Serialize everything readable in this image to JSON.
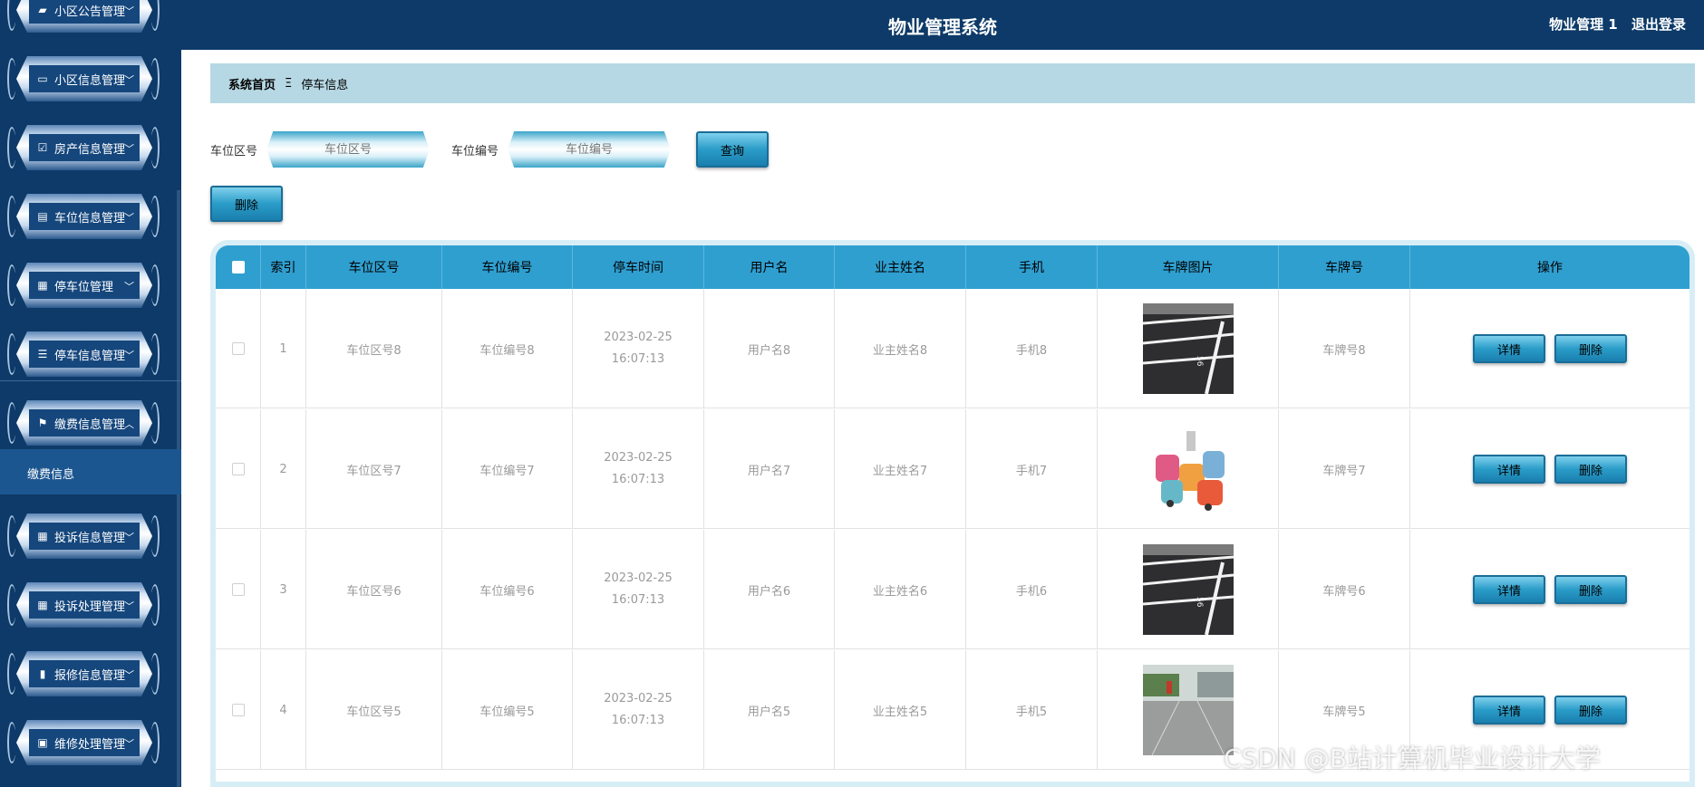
{
  "header": {
    "title": "物业管理系统",
    "user": "物业管理 1",
    "logout": "退出登录"
  },
  "sidebar": {
    "items": [
      {
        "label": "小区公告管理",
        "icon": "wallet-icon"
      },
      {
        "label": "小区信息管理",
        "icon": "monitor-icon"
      },
      {
        "label": "房产信息管理",
        "icon": "clipboard-check-icon"
      },
      {
        "label": "车位信息管理",
        "icon": "clipboard-icon"
      },
      {
        "label": "停车位管理",
        "icon": "grid-icon"
      },
      {
        "label": "停车信息管理",
        "icon": "list-icon"
      },
      {
        "label": "缴费信息管理",
        "icon": "flag-icon"
      },
      {
        "label": "投诉信息管理",
        "icon": "grid-icon"
      },
      {
        "label": "投诉处理管理",
        "icon": "grid-icon"
      },
      {
        "label": "报修信息管理",
        "icon": "book-icon"
      },
      {
        "label": "维修处理管理",
        "icon": "chat-icon"
      }
    ],
    "sub_item": "缴费信息"
  },
  "breadcrumb": {
    "home": "系统首页",
    "separator": "Ξ",
    "current": "停车信息"
  },
  "search": {
    "area_label": "车位区号",
    "area_placeholder": "车位区号",
    "number_label": "车位编号",
    "number_placeholder": "车位编号",
    "query_button": "查询",
    "delete_button": "删除"
  },
  "table": {
    "columns": [
      "索引",
      "车位区号",
      "车位编号",
      "停车时间",
      "用户名",
      "业主姓名",
      "手机",
      "车牌图片",
      "车牌号",
      "操作"
    ],
    "rows": [
      {
        "index": "1",
        "area": "车位区号8",
        "number": "车位编号8",
        "time": "2023-02-25 16:07:13",
        "user": "用户名8",
        "owner": "业主姓名8",
        "phone": "手机8",
        "plate": "车牌号8",
        "image": "parking-lot-photo"
      },
      {
        "index": "2",
        "area": "车位区号7",
        "number": "车位编号7",
        "time": "2023-02-25 16:07:13",
        "user": "用户名7",
        "owner": "业主姓名7",
        "phone": "手机7",
        "plate": "车牌号7",
        "image": "cartoon-cars-illustration"
      },
      {
        "index": "3",
        "area": "车位区号6",
        "number": "车位编号6",
        "time": "2023-02-25 16:07:13",
        "user": "用户名6",
        "owner": "业主姓名6",
        "phone": "手机6",
        "plate": "车牌号6",
        "image": "parking-lot-photo"
      },
      {
        "index": "4",
        "area": "车位区号5",
        "number": "车位编号5",
        "time": "2023-02-25 16:07:13",
        "user": "用户名5",
        "owner": "业主姓名5",
        "phone": "手机5",
        "plate": "车牌号5",
        "image": "outdoor-parking-photo"
      }
    ],
    "detail_button": "详情",
    "delete_button": "删除"
  },
  "watermark": "CSDN @B站计算机毕业设计大学",
  "colors": {
    "navy": "#0d3a68",
    "header_row": "#2f9fd0",
    "breadcrumb_bg": "#b6d8e4"
  }
}
